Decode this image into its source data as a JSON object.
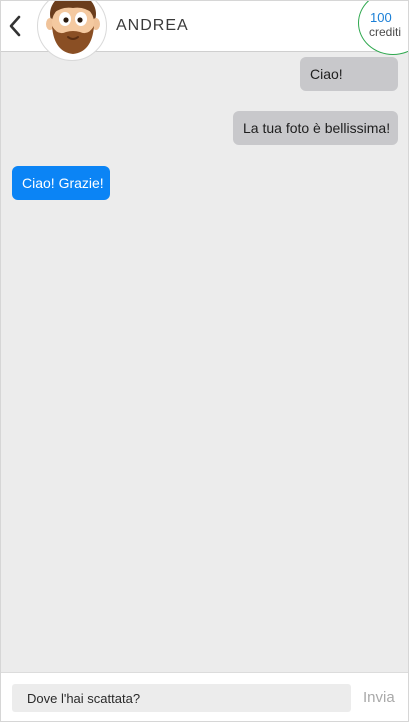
{
  "header": {
    "contact_name": "ANDREA",
    "credits_count": "100",
    "credits_label": "crediti"
  },
  "messages": [
    {
      "direction": "sent",
      "text": "Ciao!"
    },
    {
      "direction": "sent",
      "text": "La tua foto è bellissima!"
    },
    {
      "direction": "received",
      "text": "Ciao! Grazie!"
    }
  ],
  "composer": {
    "input_value": "Dove l'hai scattata?",
    "send_label": "Invia"
  },
  "colors": {
    "sent_bubble": "#c8c8cb",
    "received_bubble": "#0b84f5",
    "credits_ring": "#2fa84f",
    "credits_count": "#1a7fd6"
  },
  "icons": {
    "back": "chevron-left-icon",
    "avatar": "bearded-man-avatar"
  }
}
